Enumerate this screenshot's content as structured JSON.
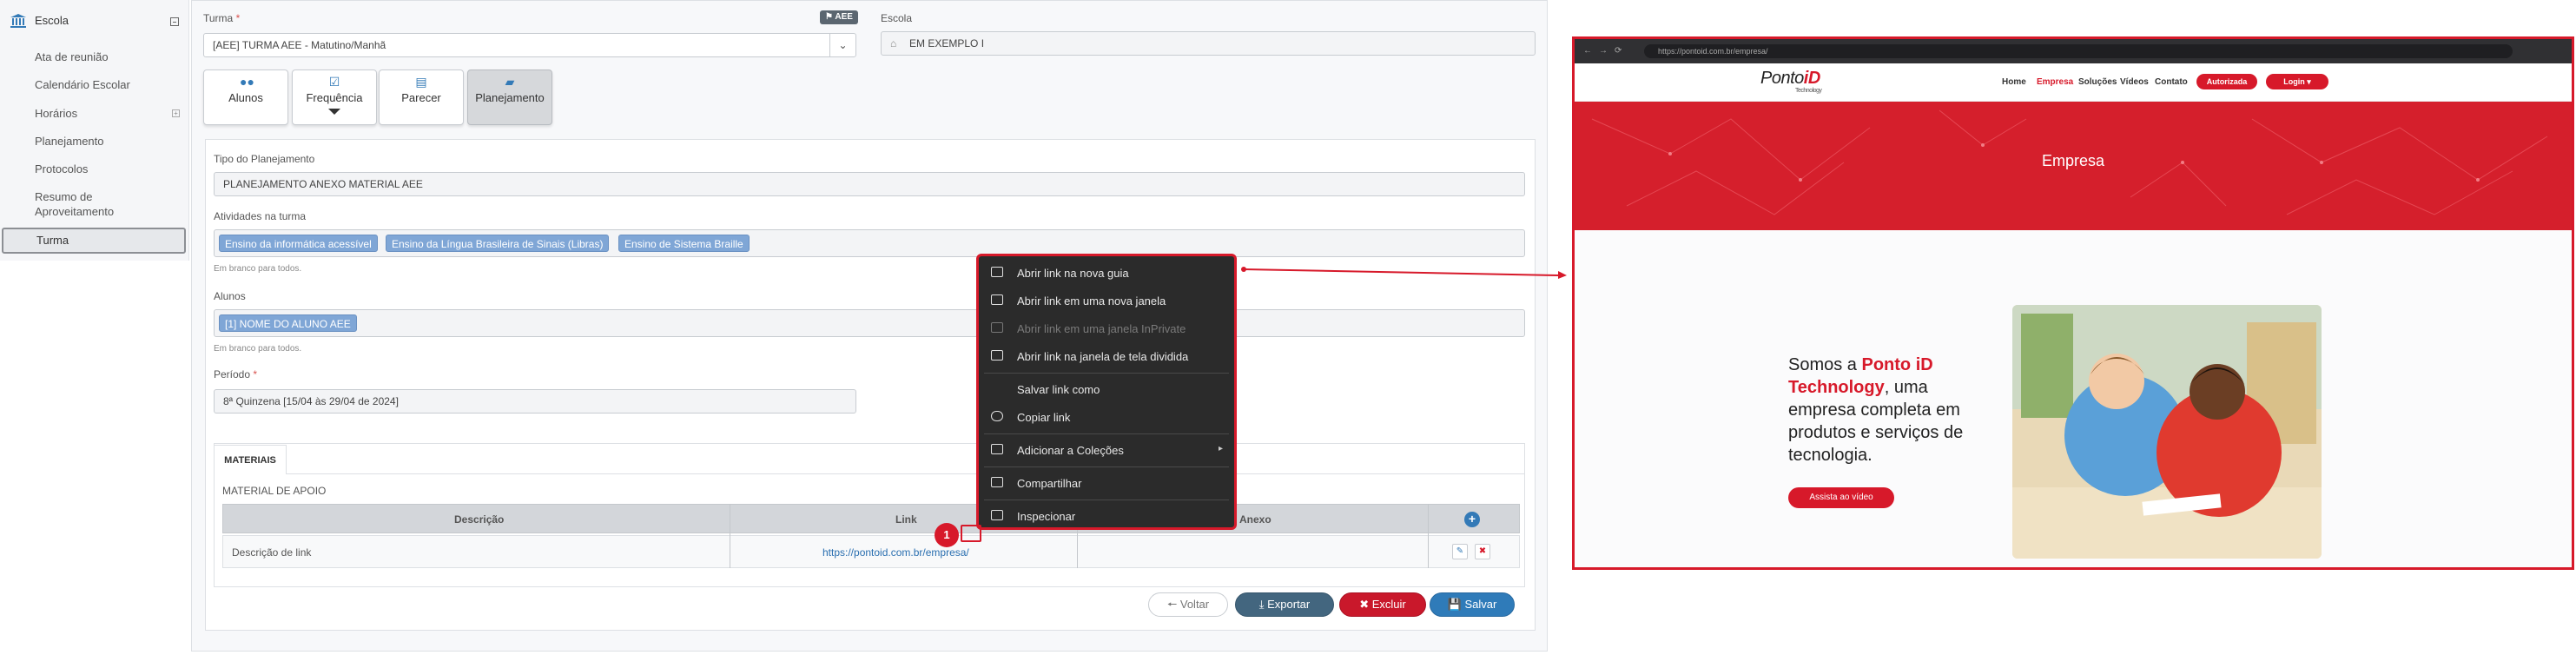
{
  "sidebar": {
    "header": "Escola",
    "items": [
      {
        "label": "Ata de reunião"
      },
      {
        "label": "Calendário Escolar"
      },
      {
        "label": "Horários"
      },
      {
        "label": "Planejamento"
      },
      {
        "label": "Protocolos"
      },
      {
        "label": "Resumo de"
      },
      {
        "label": "Aproveitamento"
      }
    ],
    "active": "Turma"
  },
  "form": {
    "turma_label": "Turma",
    "req_mark": "*",
    "turma_value": "[AEE]  TURMA AEE - Matutino/Manhã",
    "aee_badge": "AEE",
    "escola_label": "Escola",
    "escola_value": "EM EXEMPLO I",
    "tabs": [
      {
        "label": "Alunos"
      },
      {
        "label": "Frequência"
      },
      {
        "label": "Parecer"
      },
      {
        "label": "Planejamento"
      }
    ],
    "tipo_label": "Tipo do Planejamento",
    "tipo_value": "PLANEJAMENTO ANEXO MATERIAL AEE",
    "atividades_label": "Atividades na turma",
    "atividades": [
      "Ensino da informática acessível",
      "Ensino da Língua Brasileira de Sinais (Libras)",
      "Ensino de Sistema Braille"
    ],
    "hint_blank": "Em branco para todos.",
    "alunos_label": "Alunos",
    "alunos": [
      "[1] NOME DO ALUNO AEE"
    ],
    "periodo_label": "Período",
    "periodo_value": "8ª Quinzena [15/04 às 29/04 de 2024]",
    "materiais_tab": "MATERIAIS",
    "material_apoio": "MATERIAL DE APOIO",
    "table": {
      "headers": [
        "Descrição",
        "Link",
        "Anexo"
      ],
      "row": {
        "descricao": "Descrição de link",
        "link": "https://pontoid.com.br/empresa/"
      }
    },
    "buttons": {
      "voltar": "Voltar",
      "exportar": "Exportar",
      "excluir": "Excluir",
      "salvar": "Salvar"
    }
  },
  "context_menu": {
    "items": [
      {
        "label": "Abrir link na nova guia",
        "disabled": false
      },
      {
        "label": "Abrir link em uma nova janela",
        "disabled": false
      },
      {
        "label": "Abrir link em uma janela InPrivate",
        "disabled": true
      },
      {
        "label": "Abrir link na janela de tela dividida",
        "disabled": false
      },
      {
        "label": "Salvar link como",
        "disabled": false
      },
      {
        "label": "Copiar link",
        "disabled": false
      },
      {
        "label": "Adicionar a Coleções",
        "disabled": false
      },
      {
        "label": "Compartilhar",
        "disabled": false
      },
      {
        "label": "Inspecionar",
        "disabled": false
      }
    ],
    "step_marker": "1"
  },
  "browser": {
    "url": "https://pontoid.com.br/empresa/",
    "logo_a": "Ponto",
    "logo_b": "iD",
    "logo_sub": "Technology",
    "nav": [
      "Home",
      "Empresa",
      "Soluções",
      "Vídeos",
      "Contato"
    ],
    "autorizada": "Autorizada",
    "login": "Login ▾",
    "hero_title": "Empresa",
    "headline_a": "Somos a ",
    "headline_brand": "Ponto iD Technology",
    "headline_b": ", uma empresa completa em produtos e serviços de tecnologia.",
    "video_btn": "Assista ao vídeo"
  },
  "colors": {
    "accent_red": "#d7192a",
    "primary_blue": "#337ab7",
    "chip_blue": "#7fa6d6"
  }
}
